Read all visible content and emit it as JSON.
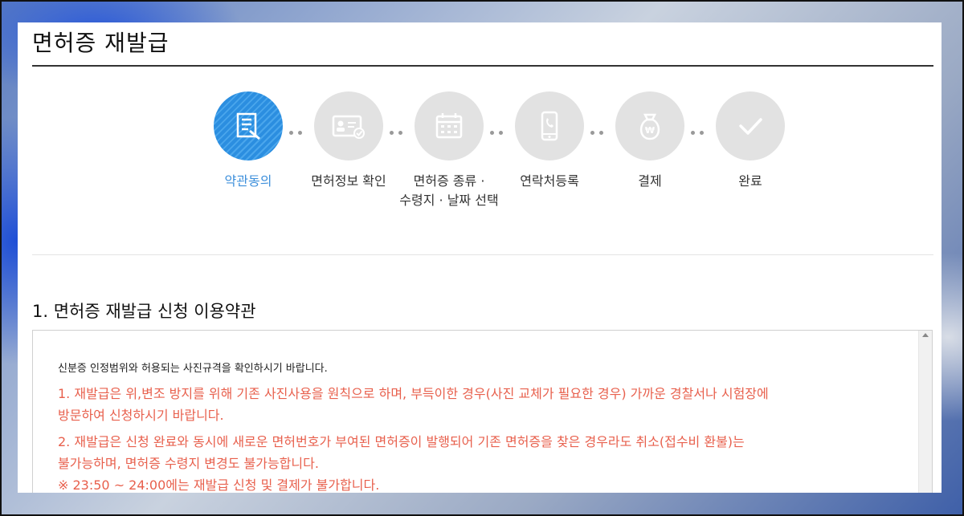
{
  "page": {
    "title": "면허증 재발급"
  },
  "steps": [
    {
      "label": "약관동의",
      "icon": "document-edit-icon",
      "active": true
    },
    {
      "label": "면허정보 확인",
      "icon": "id-card-check-icon",
      "active": false
    },
    {
      "label": "면허증 종류 ·\n수령지 · 날짜 선택",
      "icon": "calendar-icon",
      "active": false
    },
    {
      "label": "연락처등록",
      "icon": "phone-icon",
      "active": false
    },
    {
      "label": "결제",
      "icon": "money-bag-icon",
      "active": false
    },
    {
      "label": "완료",
      "icon": "check-icon",
      "active": false
    }
  ],
  "terms": {
    "section_title": "1. 면허증 재발급 신청 이용약관",
    "intro": "신분증 인정범위와 허용되는 사진규격을 확인하시기 바랍니다.",
    "item1_line1": "1. 재발급은 위,변조 방지를 위해 기존 사진사용을 원칙으로 하며, 부득이한 경우(사진 교체가 필요한 경우) 가까운 경찰서나 시험장에",
    "item1_line2": "방문하여 신청하시기 바랍니다.",
    "item2_line1": "2. 재발급은 신청 완료와 동시에 새로운 면허번호가 부여된 면허증이 발행되어 기존 면허증을 찾은 경우라도 취소(접수비 환불)는",
    "item2_line2": "불가능하며, 면허증 수령지 변경도 불가능합니다.",
    "item2_line3": "※ 23:50 ~ 24:00에는 재발급 신청 및 결제가 불가합니다."
  },
  "colors": {
    "active": "#2b8ee0",
    "inactive": "#e2e2e2",
    "warning_text": "#e8604d"
  }
}
